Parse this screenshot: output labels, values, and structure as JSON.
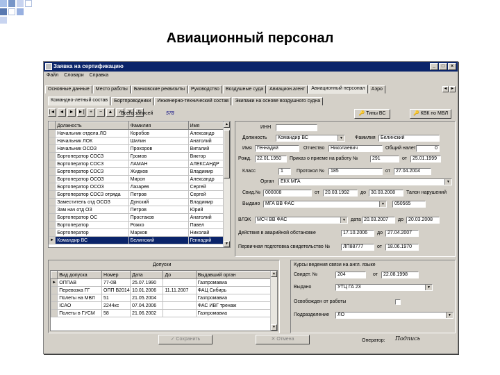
{
  "slide_title": "Авиационный персонал",
  "window": {
    "title": "Заявка на сертификацию"
  },
  "menu": [
    "Файл",
    "Словари",
    "Справка"
  ],
  "tabs": [
    "Основные данные",
    "Место работы",
    "Банковские реквизиты",
    "Руководство",
    "Воздушные суда",
    "Авиацион.агент",
    "Авиационный персонал",
    "Аэро"
  ],
  "subtabs": [
    "Командно-летный состав",
    "Бортпроводники",
    "Инженерно-технический состав",
    "Экипажи на основе воздушного судна"
  ],
  "toolbar": {
    "total_label": "Всего записей",
    "total_value": "578",
    "btn_types": "Типы ВС",
    "btn_kvk": "КВК по МВЛ"
  },
  "main_table": {
    "headers": [
      "Должность",
      "Фамилия",
      "Имя"
    ],
    "rows": [
      [
        "Начальник отдела ЛО",
        "Коробов",
        "Александр"
      ],
      [
        "Начальник ЛОК",
        "Шилин",
        "Анатолий"
      ],
      [
        "Начальник ОСОЗ",
        "Прохоров",
        "Виталий"
      ],
      [
        "Бортоператор СОСЗ",
        "Громов",
        "Виктор"
      ],
      [
        "Бортоператор СОСЗ",
        "ЛАМАН",
        "АЛЕКСАНДР"
      ],
      [
        "Бортоператор СОСЗ",
        "Жидков",
        "Владимир"
      ],
      [
        "Бортоператор ОСОЗ",
        "Мирон",
        "Александр"
      ],
      [
        "Бортоператор ОСОЗ",
        "Лазарев",
        "Сергей"
      ],
      [
        "Бортоператор СОСЗ отряда",
        "Петров",
        "Сергей"
      ],
      [
        "Заместитель отд ОСОЗ",
        "Дунский",
        "Владимир"
      ],
      [
        "Зам нач отд ОЗ",
        "Петров",
        "Юрий"
      ],
      [
        "Бортоператор ОС",
        "Простаков",
        "Анатолий"
      ],
      [
        "Бортоператор",
        "Рожко",
        "Павел"
      ],
      [
        "Бортоператор",
        "Марков",
        "Николай"
      ],
      [
        "Командир ВС",
        "Белинский",
        "Геннадий"
      ]
    ]
  },
  "form": {
    "inn_label": "ИНН",
    "position_label": "Должность",
    "position_value": "Командир ВС",
    "surname_label": "Фамилия",
    "surname_value": "Белинский",
    "name_label": "Имя",
    "name_value": "Геннадий",
    "patronymic_label": "Отчество",
    "patronymic_value": "Николаевич",
    "total_raid_label": "Общий налет",
    "total_raid_value": "0",
    "birth_label": "Рожд.",
    "birth_value": "22.01.1950",
    "order_label": "Приказ о приеме на работу №",
    "order_value": "291",
    "order_from_label": "от",
    "order_from_value": "25.01.1999",
    "class_label": "Класс",
    "class_value": "1",
    "protocol_label": "Протокол №",
    "protocol_value": "185",
    "protocol_from_label": "от",
    "protocol_from_value": "27.04.2004",
    "organ_label": "Орган",
    "organ_value": "ЕКК МГА",
    "cert_label": "Свид.№",
    "cert_value": "000008",
    "cert_from_label": "от",
    "cert_from_value": "20.03.1992",
    "cert_to_label": "до",
    "cert_to_value": "30.03.2008",
    "talon_label": "Талон нарушений",
    "issued_label": "Выдано",
    "issued_value": "МГА ВВ ФАС",
    "issued_num_value": "050565",
    "vlek_label": "ВЛЭК",
    "vlek_value": "МСЧ ВВ ФАС",
    "vlek_date_label": "дата",
    "vlek_date_value": "20.03.2007",
    "vlek_to_label": "до",
    "vlek_to_value": "20.03.2008",
    "emergency_label": "Действия в аварийной обстановке",
    "emergency_value": "17.10.2006",
    "emergency_to_label": "до",
    "emergency_to_value": "27.04.2007",
    "training_label": "Первичная подготовка свидетельство №",
    "training_value": "ЛП88777",
    "training_from_label": "от",
    "training_from_value": "18.06.1970"
  },
  "admissions": {
    "title": "Допуски",
    "headers": [
      "Вид допуска",
      "Номер",
      "Дата",
      "До",
      "Выдавший орган"
    ],
    "rows": [
      [
        "ОППАВ",
        "77-0В",
        "25.07.1990",
        "",
        "Газпромавиа"
      ],
      [
        "Перевозка ГГ",
        "ОПП В2014",
        "10.01.2006",
        "11.11.2007",
        "ФАЦ Сибирь"
      ],
      [
        "Полеты на МВЛ",
        "51",
        "21.05.2004",
        "",
        "Газпромавиа"
      ],
      [
        "ICAO",
        "2244кс",
        "07.04.2006",
        "",
        "ФАС ИВГ тренаж"
      ],
      [
        "Полеты в ГУСМ",
        "58",
        "21.06.2002",
        "",
        "Газпромавиа"
      ]
    ]
  },
  "course": {
    "title": "Курсы ведения связи на англ. языке",
    "cert_label": "Свидет. №",
    "cert_value": "204",
    "cert_from_label": "от",
    "cert_from_value": "22.08.1998",
    "issued_label": "Выдано",
    "issued_value": "УТЦ ГА 23",
    "released_label": "Освобожден от работы",
    "division_label": "Подразделение",
    "division_value": "ЛО"
  },
  "buttons": {
    "save": "Сохранить",
    "cancel": "Отмена"
  },
  "status": {
    "operator_label": "Оператор:",
    "operator_value": "Подпись"
  }
}
